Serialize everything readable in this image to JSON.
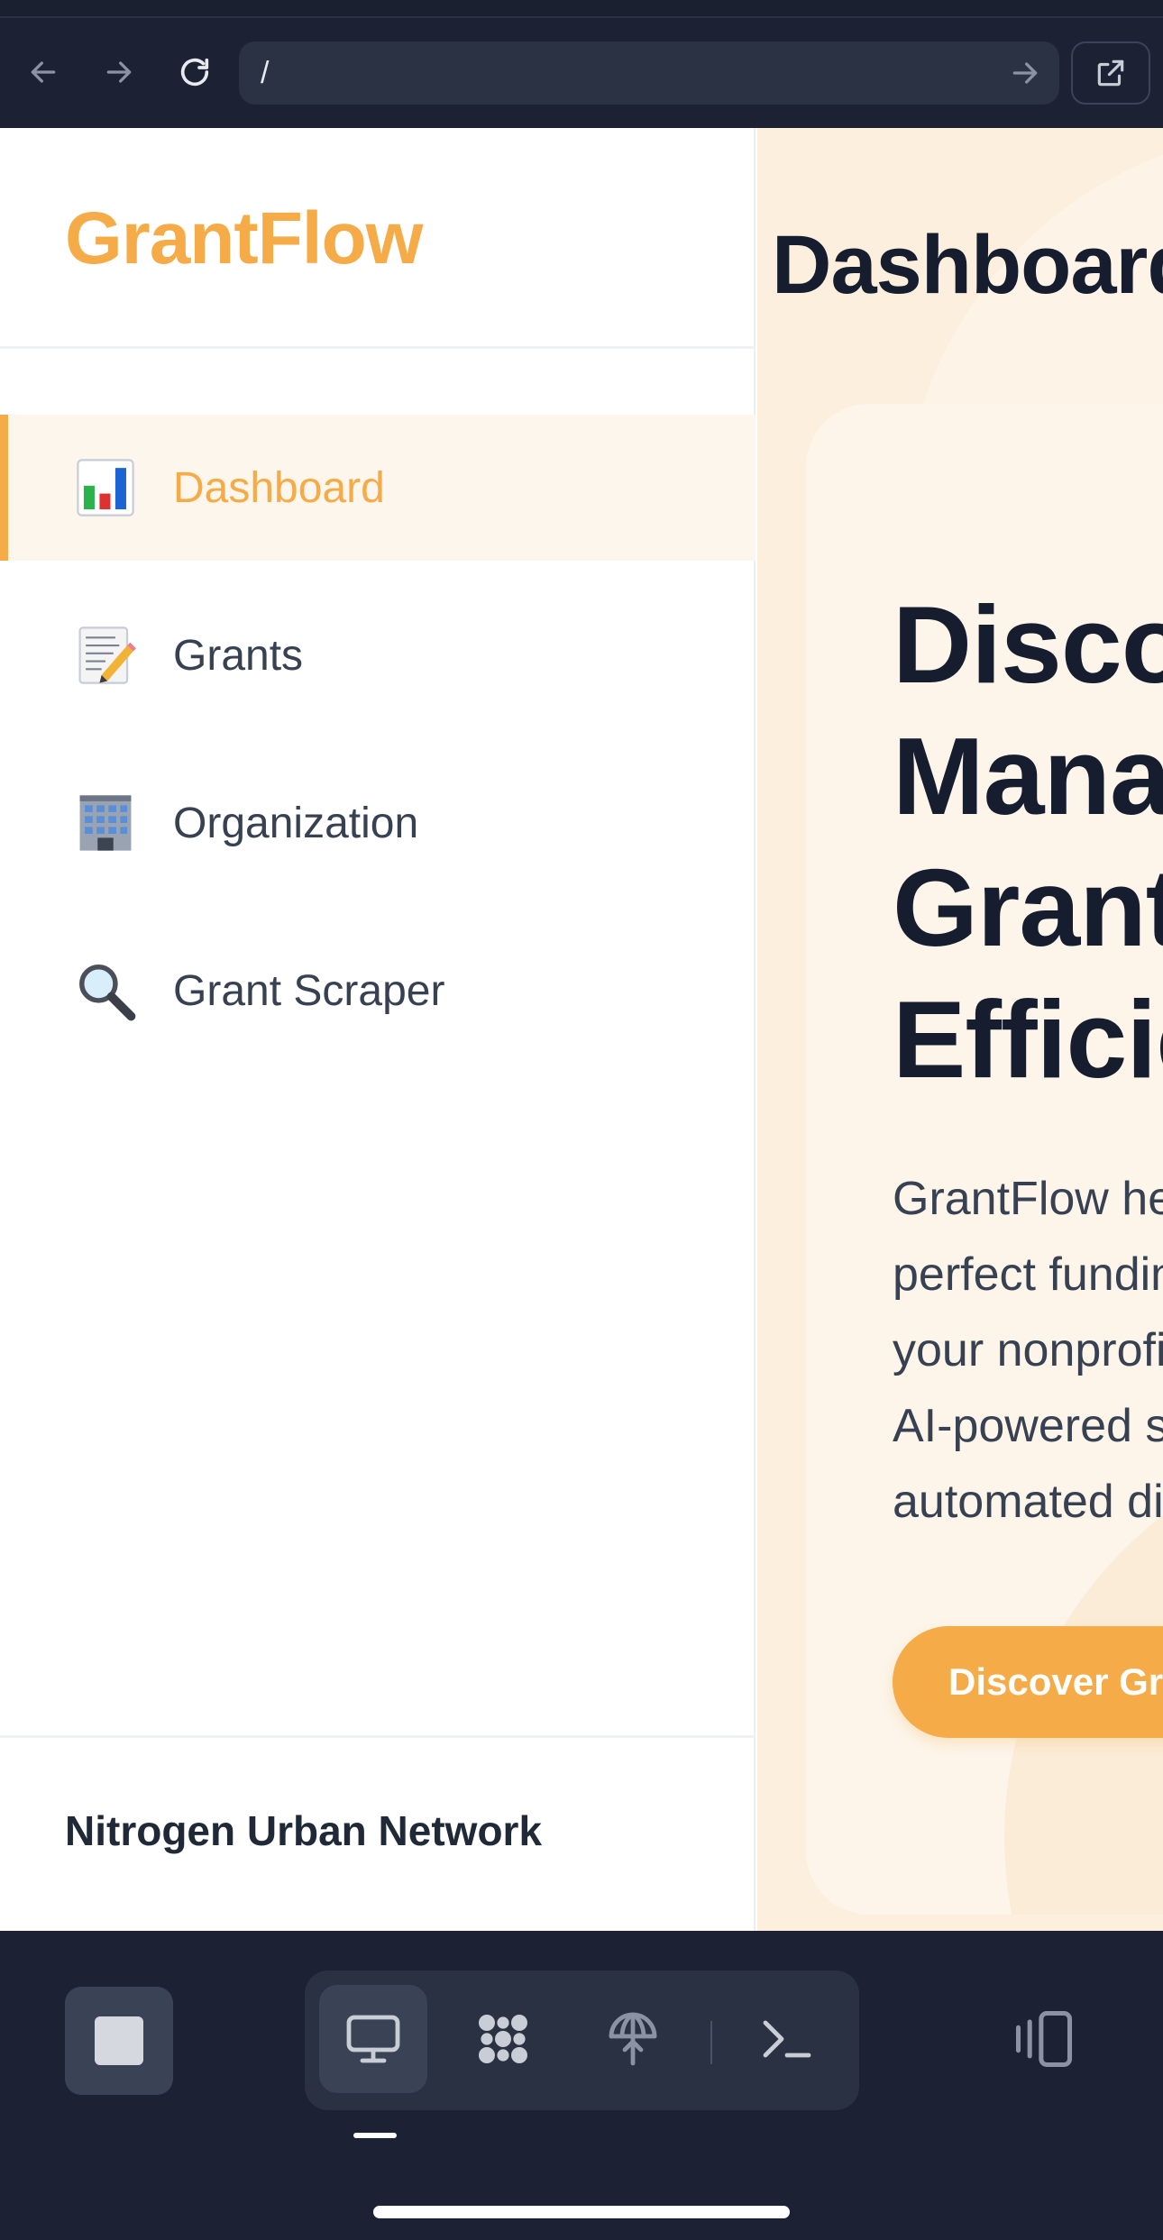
{
  "browser": {
    "url": "/",
    "icons": {
      "back": "arrow-left-icon",
      "forward": "arrow-right-icon",
      "reload": "reload-icon",
      "go": "arrow-right-icon",
      "open_external": "external-link-icon"
    }
  },
  "sidebar": {
    "brand": "GrantFlow",
    "items": [
      {
        "label": "Dashboard",
        "icon": "bar-chart-icon",
        "active": true
      },
      {
        "label": "Grants",
        "icon": "memo-pencil-icon",
        "active": false
      },
      {
        "label": "Organization",
        "icon": "office-building-icon",
        "active": false
      },
      {
        "label": "Grant Scraper",
        "icon": "magnifying-glass-icon",
        "active": false
      }
    ],
    "organization_name": "Nitrogen Urban Network"
  },
  "main": {
    "title": "Dashboard",
    "hero": {
      "heading_lines": [
        "Discover,",
        "Manage &",
        "Grants",
        "Efficiently"
      ],
      "description_lines": [
        "GrantFlow helps you find the",
        "perfect funding opportunities for",
        "your nonprofit organization with",
        "AI-powered search and",
        "automated discovery"
      ],
      "cta_label": "Discover Grants"
    }
  },
  "bottom_bar": {
    "stop": "stop-icon",
    "tools": [
      "monitor-icon",
      "apps-grid-icon",
      "antenna-icon",
      "terminal-icon"
    ],
    "device": "device-toggle-icon"
  },
  "colors": {
    "accent": "#f5ab47",
    "text_dark": "#161d2e",
    "chrome_bg": "#1c2233",
    "main_bg": "#fcefdd"
  }
}
